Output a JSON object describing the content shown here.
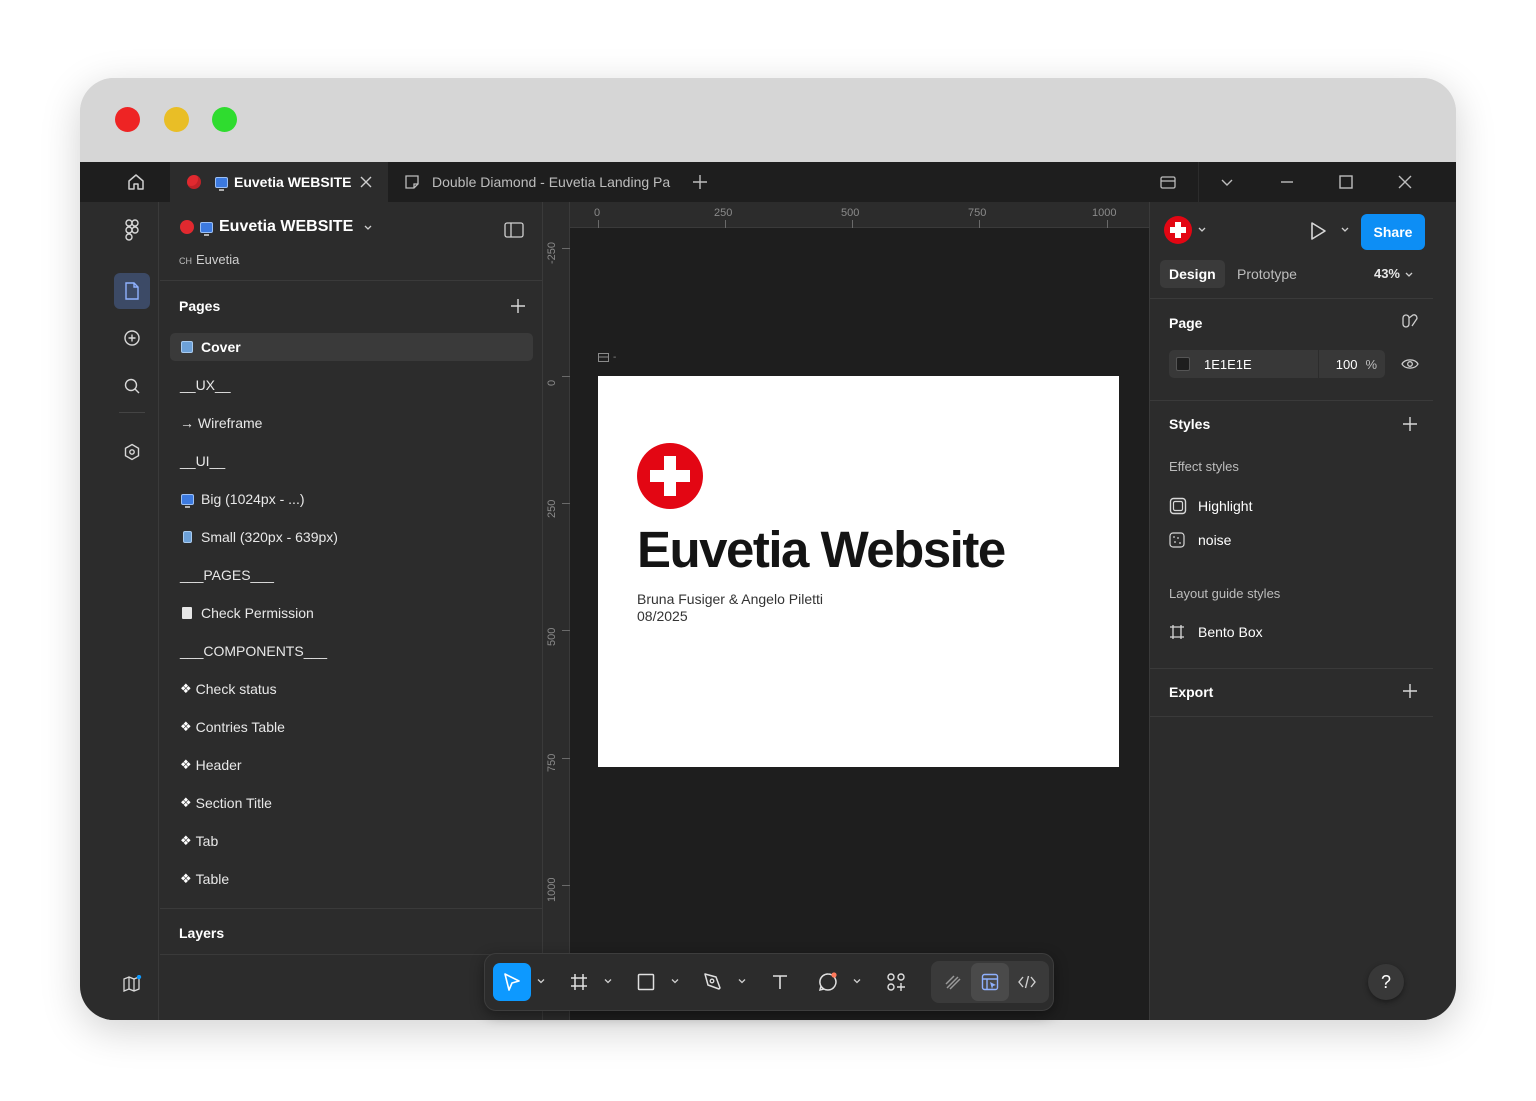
{
  "window": {
    "traffic_lights": {
      "close": "#ee2424",
      "minimize": "#e9be26",
      "maximize": "#2fdc2f"
    }
  },
  "tabbar": {
    "home_icon": "home-icon",
    "tabs": [
      {
        "label": "Euvetia WEBSITE",
        "active": true
      },
      {
        "label": "Double Diamond - Euvetia Landing Pa",
        "active": false
      }
    ]
  },
  "file": {
    "name": "Euvetia WEBSITE",
    "team_prefix": "CH",
    "team": "Euvetia"
  },
  "pages": {
    "title": "Pages",
    "items": [
      {
        "label": "Cover",
        "icon": "cover-thumb",
        "selected": true
      },
      {
        "label": "__UX__",
        "icon": ""
      },
      {
        "label": "→ Wireframe",
        "icon": ""
      },
      {
        "label": "__UI__",
        "icon": ""
      },
      {
        "label": "Big (1024px - ...)",
        "icon": "monitor"
      },
      {
        "label": "Small (320px - 639px)",
        "icon": "phone"
      },
      {
        "label": "___PAGES___",
        "icon": ""
      },
      {
        "label": "Check Permission",
        "icon": "doc"
      },
      {
        "label": "___COMPONENTS___",
        "icon": ""
      },
      {
        "label": "Check status",
        "icon": "component"
      },
      {
        "label": "Contries Table",
        "icon": "component"
      },
      {
        "label": "Header",
        "icon": "component"
      },
      {
        "label": "Section Title",
        "icon": "component"
      },
      {
        "label": "Tab",
        "icon": "component"
      },
      {
        "label": "Table",
        "icon": "component"
      }
    ]
  },
  "layers": {
    "title": "Layers"
  },
  "canvas": {
    "ruler_top": [
      "0",
      "250",
      "500",
      "750",
      "1000"
    ],
    "ruler_left": [
      "-250",
      "0",
      "250",
      "500",
      "750",
      "1000"
    ],
    "frame_label": "-",
    "frame": {
      "title": "Euvetia Website",
      "authors": "Bruna Fusiger & Angelo Piletti",
      "date": "08/2025",
      "logo_color": "#e30613"
    }
  },
  "toolbar": {
    "tools": [
      "move-tool",
      "frame-tool",
      "rectangle-tool",
      "pen-tool",
      "text-tool",
      "comment-tool",
      "actions-tool"
    ],
    "modes": [
      "draw-mode",
      "design-mode",
      "dev-mode"
    ],
    "active_tool": "move-tool"
  },
  "rpanel": {
    "share_label": "Share",
    "tabs": [
      "Design",
      "Prototype"
    ],
    "zoom": "43%",
    "page_title": "Page",
    "bg_color": "1E1E1E",
    "bg_opacity": "100",
    "pct": "%",
    "styles_title": "Styles",
    "effect_styles_title": "Effect styles",
    "effect_styles": [
      "Highlight",
      "noise"
    ],
    "layout_guide_title": "Layout guide styles",
    "layout_guides": [
      "Bento Box"
    ],
    "export_title": "Export",
    "help": "?",
    "accent": "#0d8ef5"
  }
}
